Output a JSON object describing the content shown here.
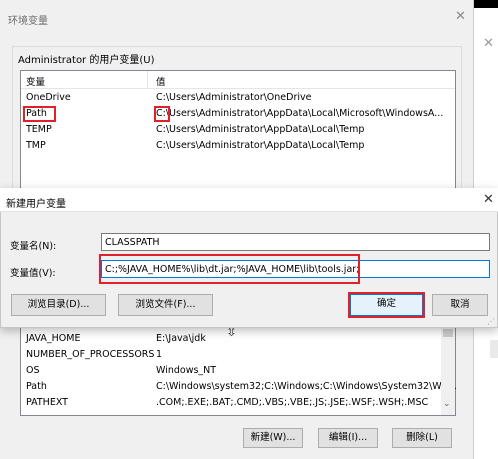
{
  "env_window": {
    "title": "环境变量",
    "close_icon": "✕",
    "user_group_label": "Administrator 的用户变量(U)",
    "user_columns": [
      "变量",
      "值"
    ],
    "user_vars": [
      {
        "name": "OneDrive",
        "value": "C:\\Users\\Administrator\\OneDrive"
      },
      {
        "name": "Path",
        "value": "C:\\Users\\Administrator\\AppData\\Local\\Microsoft\\WindowsA..."
      },
      {
        "name": "TEMP",
        "value": "C:\\Users\\Administrator\\AppData\\Local\\Temp"
      },
      {
        "name": "TMP",
        "value": "C:\\Users\\Administrator\\AppData\\Local\\Temp"
      }
    ],
    "system_vars": [
      {
        "name": "JAVA_HOME",
        "value": "E:\\Java\\jdk"
      },
      {
        "name": "NUMBER_OF_PROCESSORS",
        "value": "1"
      },
      {
        "name": "OS",
        "value": "Windows_NT"
      },
      {
        "name": "Path",
        "value": "C:\\Windows\\system32;C:\\Windows;C:\\Windows\\System32\\Wb..."
      },
      {
        "name": "PATHEXT",
        "value": ".COM;.EXE;.BAT;.CMD;.VBS;.VBE;.JS;.JSE;.WSF;.WSH;.MSC"
      }
    ],
    "buttons": {
      "new": "新建(W)...",
      "edit": "编辑(I)...",
      "delete": "删除(L)"
    }
  },
  "dialog": {
    "title": "新建用户变量",
    "close_icon": "✕",
    "name_label": "变量名(N):",
    "name_value": "CLASSPATH",
    "value_label": "变量值(V):",
    "value_value": "C:;%JAVA_HOME%\\lib\\dt.jar;%JAVA_HOME\\lib\\tools.jar;",
    "browse_dir": "浏览目录(D)...",
    "browse_file": "浏览文件(F)...",
    "ok": "确定",
    "cancel": "取消"
  },
  "colors": {
    "highlight": "#e0212b",
    "accent": "#0078d7"
  },
  "icons": {
    "resize_cursor": "⇳",
    "scroll_down": "⌄",
    "size_grip": "⋰",
    "side_close": "✕"
  }
}
